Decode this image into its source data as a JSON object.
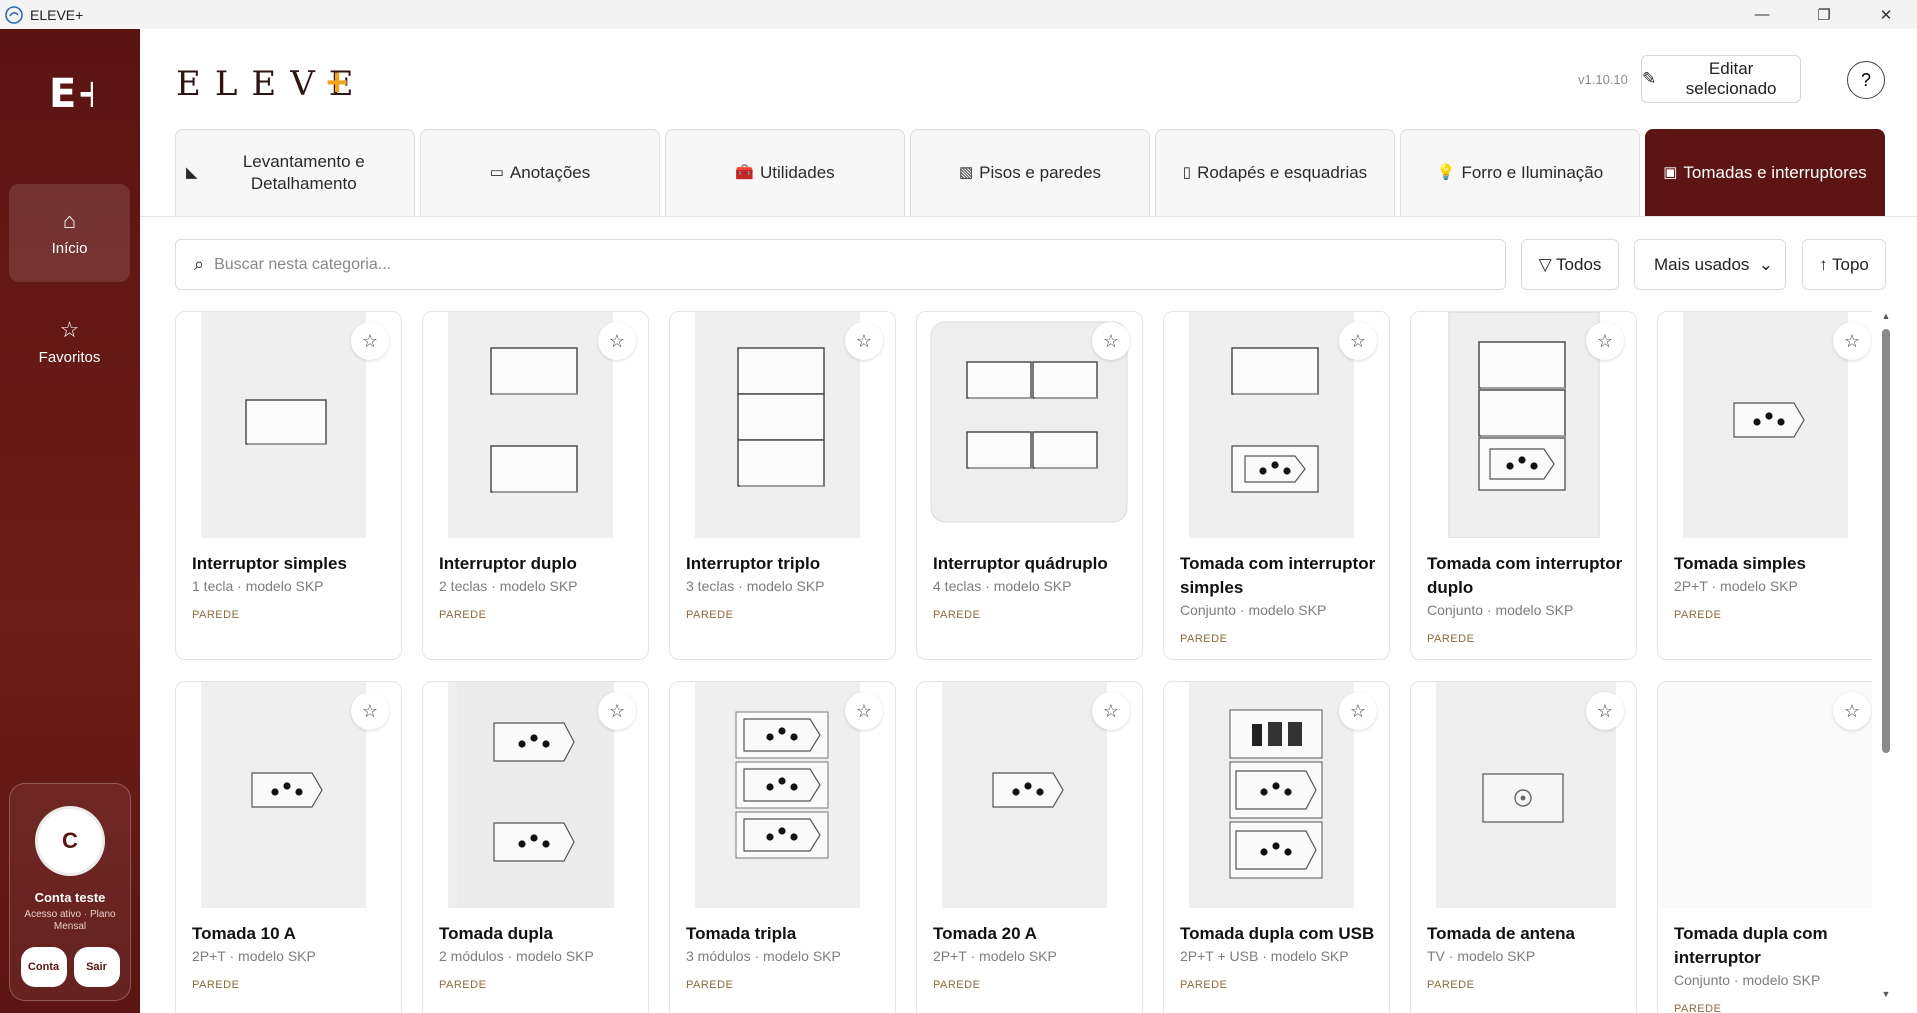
{
  "window": {
    "title": "ELEVE+",
    "controls": [
      "—",
      "❐",
      "✕"
    ]
  },
  "brand": {
    "name": "ELEVE",
    "plus": "+",
    "logo_text": "E+"
  },
  "header": {
    "version": "v1.10.10",
    "edit_label": "Editar selecionado",
    "edit_icon": "✎",
    "help_label": "?"
  },
  "sidebar": {
    "items": [
      {
        "label": "Início",
        "icon": "⌂",
        "active": true
      },
      {
        "label": "Favoritos",
        "icon": "☆",
        "active": false
      }
    ],
    "account": {
      "initial": "C",
      "name": "Conta teste",
      "status": "Acesso ativo · Plano Mensal",
      "account_button": "Conta",
      "logout_button": "Sair"
    }
  },
  "tabs": [
    {
      "label": "Levantamento e Detalhamento",
      "icon": "◣"
    },
    {
      "label": "Anotações",
      "icon": "▭"
    },
    {
      "label": "Utilidades",
      "icon": "🧰"
    },
    {
      "label": "Pisos e paredes",
      "icon": "▧"
    },
    {
      "label": "Rodapés e esquadrias",
      "icon": "▯"
    },
    {
      "label": "Forro e Iluminação",
      "icon": "💡"
    },
    {
      "label": "Tomadas e interruptores",
      "icon": "▣",
      "active": true
    }
  ],
  "toolbar": {
    "search_icon": "⌕",
    "search_placeholder": "Buscar nesta categoria...",
    "filter_label": "▽ Todos",
    "sort_value": "Mais usados",
    "sort_chevron": "⌄",
    "top_label": "↑ Topo"
  },
  "products": [
    {
      "name": "Interruptor simples",
      "meta": "1 tecla · modelo SKP",
      "tag": "PAREDE",
      "kind": "switch1"
    },
    {
      "name": "Interruptor duplo",
      "meta": "2 teclas · modelo SKP",
      "tag": "PAREDE",
      "kind": "switch2"
    },
    {
      "name": "Interruptor triplo",
      "meta": "3 teclas · modelo SKP",
      "tag": "PAREDE",
      "kind": "switch3"
    },
    {
      "name": "Interruptor quádruplo",
      "meta": "4 teclas · modelo SKP",
      "tag": "PAREDE",
      "kind": "switch4"
    },
    {
      "name": "Tomada com interruptor simples",
      "meta": "Conjunto · modelo SKP",
      "tag": "PAREDE",
      "kind": "socket_switch1"
    },
    {
      "name": "Tomada com interruptor duplo",
      "meta": "Conjunto · modelo SKP",
      "tag": "PAREDE",
      "kind": "socket_switch2"
    },
    {
      "name": "Tomada simples",
      "meta": "2P+T · modelo SKP",
      "tag": "PAREDE",
      "kind": "socket1"
    },
    {
      "name": "Tomada 10 A",
      "meta": "2P+T · modelo SKP",
      "tag": "PAREDE",
      "kind": "socket1"
    },
    {
      "name": "Tomada dupla",
      "meta": "2 módulos · modelo SKP",
      "tag": "PAREDE",
      "kind": "socket2"
    },
    {
      "name": "Tomada tripla",
      "meta": "3 módulos · modelo SKP",
      "tag": "PAREDE",
      "kind": "socket3"
    },
    {
      "name": "Tomada 20 A",
      "meta": "2P+T · modelo SKP",
      "tag": "PAREDE",
      "kind": "socket1"
    },
    {
      "name": "Tomada dupla com USB",
      "meta": "2P+T + USB · modelo SKP",
      "tag": "PAREDE",
      "kind": "socket_usb"
    },
    {
      "name": "Tomada de antena",
      "meta": "TV · modelo SKP",
      "tag": "PAREDE",
      "kind": "antenna"
    },
    {
      "name": "Tomada dupla com interruptor",
      "meta": "Conjunto · modelo SKP",
      "tag": "PAREDE",
      "kind": "blank"
    }
  ],
  "favorite_icon": "☆",
  "scrollbar": {
    "up": "▲",
    "down": "▼"
  }
}
